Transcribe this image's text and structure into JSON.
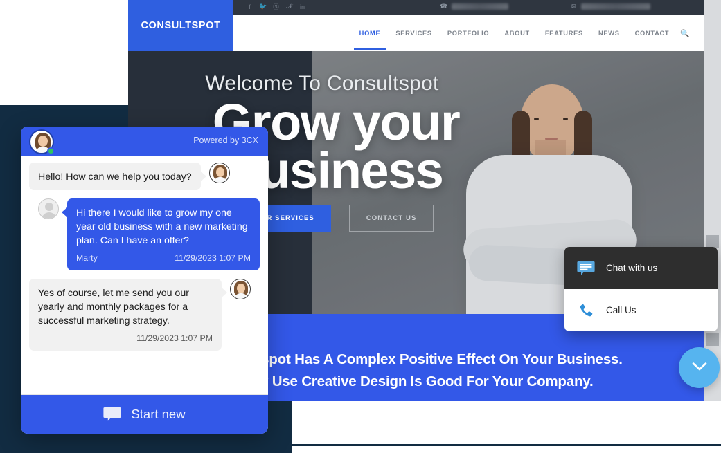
{
  "website": {
    "brand": "CONSULTSPOT",
    "social_icons": [
      "facebook-icon",
      "twitter-icon",
      "dribbble-icon",
      "pinterest-icon",
      "linkedin-icon"
    ],
    "topbar": {
      "phone_icon": "phone-icon",
      "phone_value": "",
      "mail_icon": "mail-icon",
      "mail_value": ""
    },
    "nav": [
      {
        "label": "HOME",
        "active": true
      },
      {
        "label": "SERVICES",
        "active": false
      },
      {
        "label": "PORTFOLIO",
        "active": false
      },
      {
        "label": "ABOUT",
        "active": false
      },
      {
        "label": "FEATURES",
        "active": false
      },
      {
        "label": "NEWS",
        "active": false
      },
      {
        "label": "CONTACT",
        "active": false
      }
    ],
    "search_icon": "search-icon",
    "hero": {
      "subtitle": "Welcome To Consultspot",
      "title": "Grow your business",
      "primary_button": "OUR SERVICES",
      "secondary_button": "CONTACT US"
    },
    "band": {
      "line1": "Consultspot Has A Complex Positive Effect On Your Business.",
      "line2": "Why Use Creative Design Is Good For Your Company."
    },
    "colors": {
      "brand_blue": "#2f5fe0",
      "band_blue": "#3358e8",
      "page_navy": "#122c42",
      "fab_blue": "#56b4ef"
    }
  },
  "cta_panel": {
    "rows": [
      {
        "label": "Chat with us",
        "icon": "chat-bubble-icon",
        "highlighted": true
      },
      {
        "label": "Call Us",
        "icon": "phone-handset-icon",
        "highlighted": false
      }
    ]
  },
  "fab": {
    "icon": "chevron-down-icon"
  },
  "chat_widget": {
    "header": {
      "powered_by": "Powered by 3CX",
      "avatar": "agent-avatar",
      "status": "online"
    },
    "messages": [
      {
        "from": "agent",
        "text": "Hello! How can we help you today?",
        "sender": "",
        "time": ""
      },
      {
        "from": "user",
        "text": "Hi there I would like to grow my one year old business with a new marketing plan. Can I have an offer?",
        "sender": "Marty",
        "time": "11/29/2023 1:07 PM"
      },
      {
        "from": "agent",
        "text": "Yes of course, let me send you our yearly and monthly packages for a successful marketing strategy.",
        "sender": "",
        "time": "11/29/2023 1:07 PM"
      }
    ],
    "footer": {
      "label": "Start new",
      "icon": "chat-bubble-icon"
    }
  }
}
